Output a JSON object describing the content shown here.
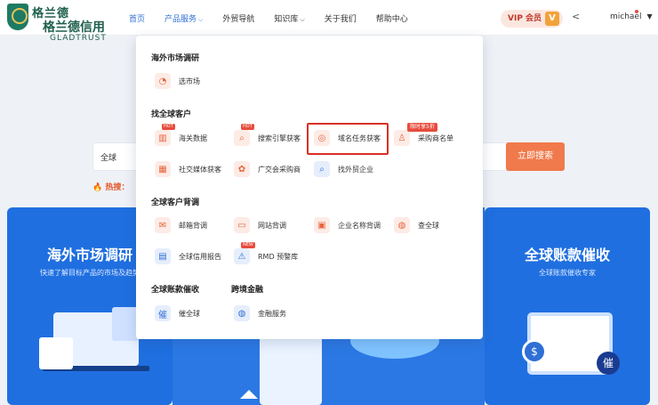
{
  "header": {
    "logo_cn_top": "格兰德",
    "logo_cn": "格兰德信用",
    "logo_en": "GLADTRUST",
    "nav": [
      {
        "label": "首页",
        "active": true,
        "dropdown": false
      },
      {
        "label": "产品服务",
        "active": false,
        "dropdown": true
      },
      {
        "label": "外贸导航",
        "active": false,
        "dropdown": false
      },
      {
        "label": "知识库",
        "active": false,
        "dropdown": true
      },
      {
        "label": "关于我们",
        "active": false,
        "dropdown": false
      },
      {
        "label": "帮助中心",
        "active": false,
        "dropdown": false
      }
    ],
    "vip_label": "VIP 会员",
    "vip_badge": "V",
    "user_name": "michael",
    "icons": {
      "share": "share-icon",
      "dropdown": "caret-down-icon"
    }
  },
  "search": {
    "value": "全球",
    "button": "立即搜索",
    "hot_label": "热搜："
  },
  "banners": {
    "left_title": "海外市场调研",
    "left_sub": "快速了解目标产品的市场及趋势",
    "right_title": "全球账款催收",
    "right_sub": "全球账款催收专家",
    "right_badge": "催"
  },
  "dropdown": {
    "sections": {
      "s1": "海外市场调研",
      "s2": "找全球客户",
      "s3": "全球客户背调",
      "s4": "全球账款催收",
      "s5": "跨境金融"
    },
    "items": {
      "xuanshichang": "选市场",
      "haiguan": "海关数据",
      "sousuo": "搜索引擎获客",
      "yuming": "域名任务获客",
      "caigou": "采购商名单",
      "shejiao": "社交媒体获客",
      "guangjiaohui": "广交会采购商",
      "zhaowaimao": "找外贸企业",
      "youxiang": "邮箱背调",
      "wangzhan": "网站背调",
      "qiye": "企业名称背调",
      "chaquanqiu": "查全球",
      "xinyong": "全球信用报告",
      "rmd": "RMD 预警库",
      "cuiquanqiu": "催全球",
      "jinrong": "金融服务"
    },
    "badges": {
      "hot": "HOT",
      "new": "NEW",
      "promo": "限时享5折"
    }
  }
}
